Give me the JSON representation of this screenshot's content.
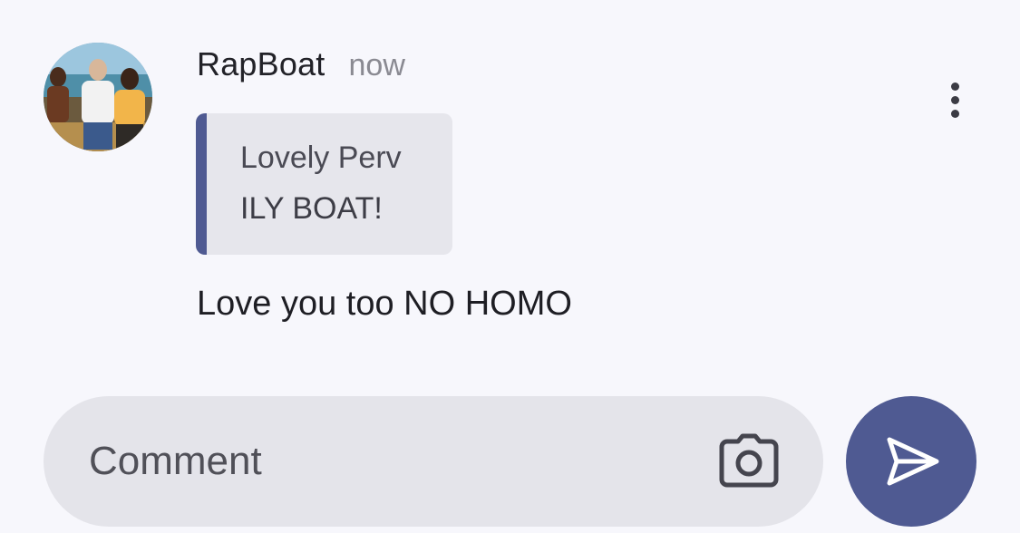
{
  "post": {
    "author": "RapBoat",
    "time": "now",
    "avatar_icon": "group-photo-avatar",
    "menu_icon": "more-vertical-icon"
  },
  "quote": {
    "author": "Lovely Perv",
    "text": "ILY BOAT!"
  },
  "message": {
    "text": "Love you too NO HOMO"
  },
  "composer": {
    "placeholder": "Comment",
    "camera_icon": "camera-icon",
    "send_icon": "send-icon"
  },
  "colors": {
    "accent": "#4f5a92",
    "background": "#f7f7fc",
    "bubble": "#e6e6ec"
  }
}
